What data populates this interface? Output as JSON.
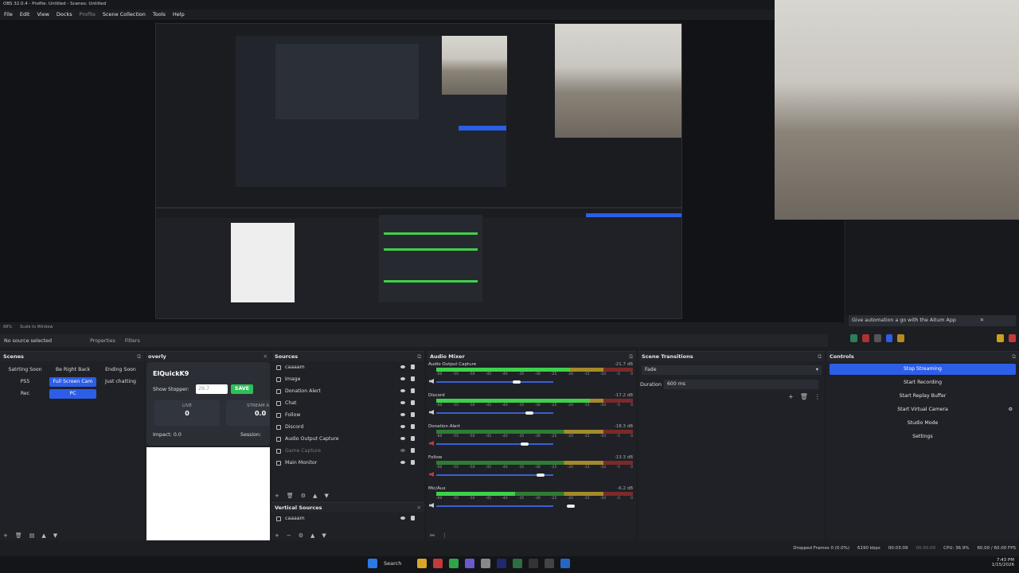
{
  "window_title": "OBS 32.0.4 - Profile: Untitled - Scenes: Untitled",
  "menu": [
    "File",
    "Edit",
    "View",
    "Docks",
    "Profile",
    "Scene Collection",
    "Tools",
    "Help"
  ],
  "preview_status": {
    "zoom": "68%",
    "scale": "Scale to Window"
  },
  "source_bar": {
    "no_source": "No source selected",
    "properties": "Properties",
    "filters": "Filters"
  },
  "automation_banner": {
    "text": "Give automation a go with the Aitum App",
    "close": "✕"
  },
  "scenes": {
    "title": "Scenes",
    "items": [
      "Satrting Soon",
      "Be Right Back",
      "Ending Soon",
      "PS5",
      "Full Screen Cam",
      "Just chatting",
      "Rec",
      "PC"
    ],
    "selected": [
      "Full Screen Cam",
      "PC"
    ]
  },
  "overly": {
    "title": "overly",
    "brand": "ElQuickK9",
    "show_stopper_label": "Show Stopper:",
    "show_stopper_value": "29.7",
    "save": "SAVE",
    "live_label": "LIVE",
    "live_value": "0",
    "stream_label": "STREAM A",
    "stream_value": "0.0",
    "impact": "Impact: 0.0",
    "session": "Session:"
  },
  "sources": {
    "title": "Sources",
    "items": [
      "caaaam",
      "Image",
      "Donation Alert",
      "Chat",
      "Follow",
      "Discord",
      "Audio Output Capture",
      "Game Capture",
      "Main Monitor"
    ]
  },
  "vertical_sources": {
    "title": "Vertical Sources",
    "items": [
      "caaaam"
    ]
  },
  "audio_mixer": {
    "title": "Audio Mixer",
    "scale": [
      "-60",
      "-55",
      "-50",
      "-45",
      "-40",
      "-35",
      "-30",
      "-25",
      "-20",
      "-15",
      "-10",
      "-5",
      "0"
    ],
    "channels": [
      {
        "name": "Audio Output Capture",
        "db": "-21.7 dB",
        "level": 0.68,
        "muted": false
      },
      {
        "name": "Discord",
        "db": "-17.2 dB",
        "level": 0.78,
        "muted": false
      },
      {
        "name": "Donation Alert",
        "db": "-18.3 dB",
        "level": 0.0,
        "muted": true
      },
      {
        "name": "Follow",
        "db": "-13.3 dB",
        "level": 0.0,
        "muted": true
      },
      {
        "name": "Mic/Aux",
        "db": "-6.2 dB",
        "level": 0.4,
        "muted": false
      }
    ]
  },
  "scene_transitions": {
    "title": "Scene Transitions",
    "transition": "Fade",
    "duration_label": "Duration",
    "duration_value": "600 ms"
  },
  "controls": {
    "title": "Controls",
    "buttons": [
      "Stop Streaming",
      "Start Recording",
      "Start Replay Buffer",
      "Start Virtual Camera",
      "Studio Mode",
      "Settings"
    ]
  },
  "status": {
    "dropped": "Dropped Frames 0 (0.0%)",
    "kbps": "6190 kbps",
    "live_time": "00:03:09",
    "rec_time": "00:00:00",
    "cpu": "CPU: 36.9%",
    "fps": "60.00 / 60.00 FPS"
  },
  "taskbar": {
    "search": "Search",
    "time": "7:43 PM",
    "date": "1/15/2026"
  },
  "colors": {
    "accent": "#2c5ee8",
    "save_green": "#2fbf5a",
    "meter_green": "#3fd04a"
  }
}
